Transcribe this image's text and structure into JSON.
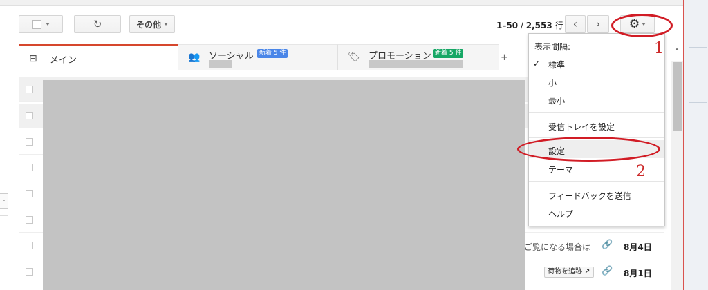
{
  "toolbar": {
    "refresh_glyph": "↻",
    "more_label": "その他",
    "pager_range": "1–50",
    "pager_sep": " / ",
    "pager_total": "2,553",
    "pager_unit": " 行",
    "prev_glyph": "‹",
    "next_glyph": "›",
    "gear_glyph": "⚙"
  },
  "tabs": [
    {
      "label": "メイン",
      "icon": "inbox-icon",
      "glyph": "⊟"
    },
    {
      "label": "ソーシャル",
      "icon": "people-icon",
      "glyph": "👥",
      "badge": "新着 5 件",
      "badge_color": "#4a86e8"
    },
    {
      "label": "プロモーション",
      "icon": "tag-icon",
      "glyph": "🏷",
      "badge": "新着 5 件",
      "badge_color": "#16a765"
    }
  ],
  "tab_plus": "+",
  "rows": [
    {
      "snippet": "",
      "date": ""
    },
    {
      "snippet": "",
      "date": ""
    },
    {
      "snippet": "",
      "date": ""
    },
    {
      "snippet": "",
      "date": ""
    },
    {
      "snippet": "",
      "date": ""
    },
    {
      "snippet": "",
      "date": ""
    },
    {
      "snippet": "ご覧になる場合は",
      "date": "8月4日"
    },
    {
      "snippet": "",
      "track_label": "荷物を追跡 ↗",
      "date": "8月1日"
    }
  ],
  "side_stub": "-",
  "menu": {
    "header": "表示間隔:",
    "check": "✓",
    "density": [
      "標準",
      "小",
      "最小"
    ],
    "configure_inbox": "受信トレイを設定",
    "settings": "設定",
    "themes": "テーマ",
    "feedback": "フィードバックを送信",
    "help": "ヘルプ"
  },
  "annotations": [
    "1",
    "2"
  ],
  "colors": {
    "accent_tab": "#d6472d",
    "annotation_red": "#d11c25"
  }
}
